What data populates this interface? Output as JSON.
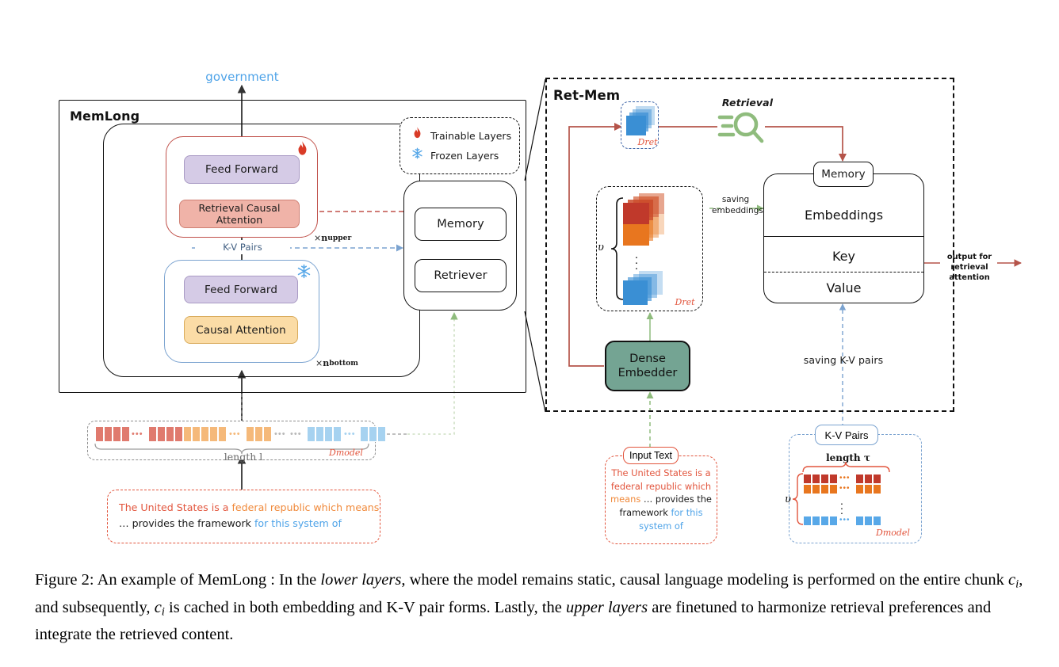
{
  "figure": {
    "model_title": "MemLong",
    "output_token": "government",
    "retmem_title": "Ret-Mem"
  },
  "memlong": {
    "upper_blocks": [
      "Feed Forward",
      "Retrieval Causal Attention"
    ],
    "lower_blocks": [
      "Feed Forward",
      "Causal Attention"
    ],
    "upper_repeat": "n",
    "upper_repeat_sub": "upper",
    "lower_repeat": "n",
    "lower_repeat_sub": "bottom",
    "repeat_prefix": "×",
    "kv_pairs_label": "K-V Pairs",
    "memret_items": [
      "Memory",
      "Retriever"
    ]
  },
  "legend": {
    "items": [
      {
        "icon": "flame-icon",
        "label": "Trainable Layers"
      },
      {
        "icon": "snowflake-icon",
        "label": "Frozen Layers"
      }
    ]
  },
  "retmem": {
    "dret_label": "D",
    "dret_sub": "ret",
    "retrieval_label": "Retrieval",
    "saving_embeddings_label": "saving\nembeddings",
    "saving_embeddings_line1": "saving",
    "saving_embeddings_line2": "embeddings",
    "saving_kv_label": "saving K-V pairs",
    "dense_embedder_line1": "Dense",
    "dense_embedder_line2": "Embedder",
    "v_symbol": "υ",
    "memory_cap": "Memory",
    "memory_rows": [
      "Embeddings",
      "Key",
      "Value"
    ],
    "output_line1": "output for",
    "output_line2": "retrieval attention"
  },
  "bottom_left": {
    "length_label": "length l",
    "dmodel_label": "D",
    "dmodel_sub": "model",
    "text_segments": [
      {
        "text": "The United States is a ",
        "color": "#e2553d"
      },
      {
        "text": "federal republic which means",
        "color": "#f0893a"
      },
      {
        "text": "\n",
        "color": "#000000"
      },
      {
        "text": "…  provides the framework ",
        "color": "#1a1a1a"
      },
      {
        "text": "for this system of",
        "color": "#4ea3e8"
      }
    ],
    "line1_a": "The United States is a ",
    "line1_b": "federal republic which means",
    "line2_a": "…  provides the framework ",
    "line2_b": "for this system of"
  },
  "bottom_mid": {
    "chip_label": "Input Text",
    "lines": [
      [
        {
          "t": "The United States is a",
          "c": "#e2553d"
        }
      ],
      [
        {
          "t": "federal republic which",
          "c": "#e2553d"
        }
      ],
      [
        {
          "t": "means ",
          "c": "#f0893a"
        },
        {
          "t": "…  provides the",
          "c": "#1a1a1a"
        }
      ],
      [
        {
          "t": "framework ",
          "c": "#1a1a1a"
        },
        {
          "t": "for this",
          "c": "#4ea3e8"
        }
      ],
      [
        {
          "t": "system of",
          "c": "#4ea3e8"
        }
      ]
    ]
  },
  "bottom_right": {
    "chip_label": "K-V Pairs",
    "length_label": "length τ",
    "v_symbol": "υ",
    "dmodel_label": "D",
    "dmodel_sub": "model"
  },
  "colors": {
    "red": "#c0514a",
    "blue": "#7ba3d0",
    "green": "#8fbc7d",
    "orange": "#f0893a",
    "token_red": "#e07a6e",
    "token_orange": "#f5b97a",
    "token_blue": "#a6d2f0",
    "embed_dark_red": "#c0392b",
    "embed_orange": "#e8761f",
    "embed_blue": "#3a8fd4",
    "teal": "#74a493",
    "flame": "#d93b27",
    "snow": "#58a8e8"
  },
  "caption": {
    "prefix": "Figure 2: An example of MemLong : In the ",
    "em1": "lower layers",
    "mid1": ", where the model remains static, causal language modeling is performed on the entire chunk ",
    "c1": "c",
    "c1sub": "i",
    "mid2": ", and subsequently, ",
    "c2": "c",
    "c2sub": "i",
    "mid3": " is cached in both embedding and K-V pair forms. Lastly, the ",
    "em2": "upper layers",
    "tail": " are finetuned to harmonize retrieval preferences and integrate the retrieved content."
  }
}
